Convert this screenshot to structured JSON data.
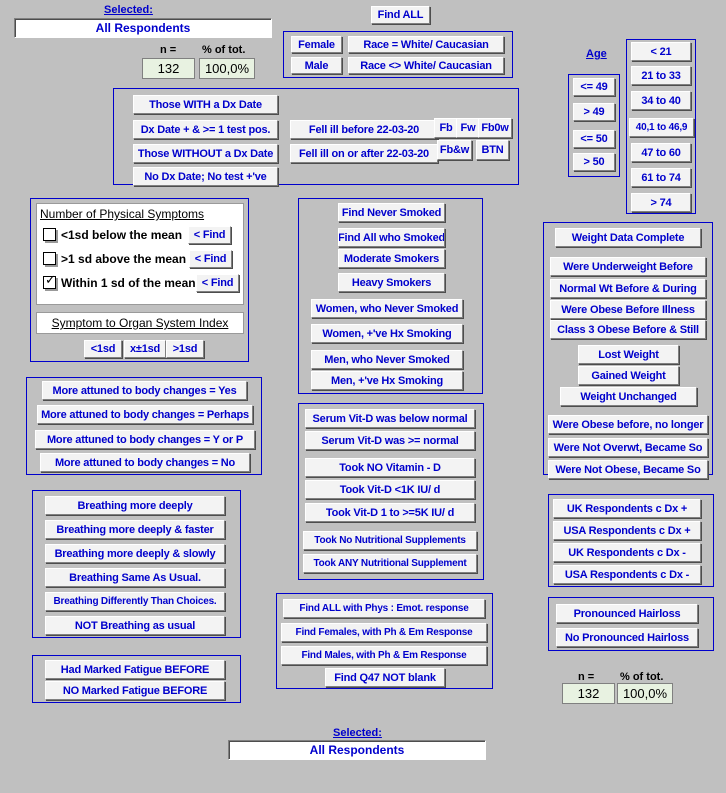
{
  "top": {
    "selected_label": "Selected:",
    "selected_value": "All Respondents",
    "n_label": "n =",
    "pct_label": "% of tot.",
    "n_value": "132",
    "pct_value": "100,0%",
    "find_all": "Find ALL"
  },
  "sex_race": {
    "female": "Female",
    "male": "Male",
    "race_white": "Race = White/ Caucasian",
    "race_nonwhite": "Race <> White/ Caucasian"
  },
  "age": {
    "title": "Age",
    "cut_buttons": [
      "<= 49",
      "> 49",
      "<= 50",
      "> 50"
    ],
    "band_buttons": [
      "< 21",
      "21 to 33",
      "34  to 40",
      "40,1 to 46,9",
      "47  to 60",
      "61  to 74",
      "> 74"
    ]
  },
  "dx": {
    "with_dx_date": "Those WITH a Dx Date",
    "dx_date_pos": "Dx Date + & >= 1 test pos.",
    "without_dx_date": "Those WITHOUT a Dx Date",
    "no_dx_no_test": "No Dx Date; No test +'ve",
    "fell_before": "Fell ill before 22-03-20",
    "fell_after": "Fell ill on or after 22-03-20",
    "fb": "Fb",
    "fw": "Fw",
    "fb0w": "Fb0w",
    "fbw": "Fb&w",
    "btn": "BTN"
  },
  "symptoms": {
    "title": "Number of Physical Symptoms",
    "rows": [
      {
        "label": "<1sd below the mean",
        "checked": false,
        "find": "< Find"
      },
      {
        "label": ">1 sd above the mean",
        "checked": false,
        "find": "< Find"
      },
      {
        "label": "Within 1 sd of the mean",
        "checked": true,
        "find": "< Find"
      }
    ],
    "index_title": "Symptom to Organ System Index",
    "index_buttons": [
      "<1sd",
      "x±1sd",
      ">1sd"
    ]
  },
  "attuned": {
    "buttons": [
      "More attuned to body changes = Yes",
      "More attuned to body changes = Perhaps",
      "More attuned to body changes = Y or P",
      "More attuned to body changes = No"
    ]
  },
  "breathing": {
    "buttons": [
      "Breathing more deeply",
      "Breathing more deeply & faster",
      "Breathing more deeply & slowly",
      "Breathing Same As Usual.",
      "Breathing Differently Than Choices.",
      "NOT Breathing as usual"
    ]
  },
  "fatigue": {
    "buttons": [
      "Had Marked Fatigue BEFORE",
      "NO Marked Fatigue BEFORE"
    ]
  },
  "smoking": {
    "buttons": [
      "Find Never Smoked",
      "Find All who Smoked",
      "Moderate Smokers",
      "Heavy Smokers",
      "Women, who Never Smoked",
      "Women, +'ve Hx Smoking",
      "Men, who Never Smoked",
      "Men, +'ve Hx Smoking"
    ]
  },
  "vitd": {
    "buttons": [
      "Serum Vit-D was below normal",
      "Serum Vit-D was >= normal",
      "Took NO Vitamin - D",
      "Took Vit-D <1K IU/ d",
      "Took Vit-D 1 to >=5K IU/ d",
      "Took No Nutritional Supplements",
      "Took ANY Nutritional Supplement"
    ]
  },
  "phys_emot": {
    "buttons": [
      "Find ALL with Phys : Emot. response",
      "Find Females, with Ph & Em Response",
      "Find Males, with Ph & Em Response",
      "Find Q47 NOT blank"
    ]
  },
  "weight": {
    "buttons": [
      "Weight Data Complete",
      "Were Underweight Before",
      "Normal Wt Before & During",
      "Were Obese Before Illness",
      "Class 3 Obese Before & Still",
      "Lost Weight",
      "Gained Weight",
      "Weight Unchanged",
      "Were Obese before, no longer",
      "Were Not Overwt, Became So",
      "Were Not Obese, Became So"
    ]
  },
  "country": {
    "buttons": [
      "UK Respondents c Dx +",
      "USA Respondents c Dx +",
      "UK Respondents c Dx -",
      "USA Respondents c Dx -"
    ]
  },
  "hairloss": {
    "buttons": [
      "Pronounced Hairloss",
      "No Pronounced Hairloss"
    ]
  },
  "bottom_stats": {
    "n_label": "n =",
    "pct_label": "% of tot.",
    "n_value": "132",
    "pct_value": "100,0%"
  },
  "bottom": {
    "selected_label": "Selected:",
    "selected_value": "All Respondents"
  }
}
